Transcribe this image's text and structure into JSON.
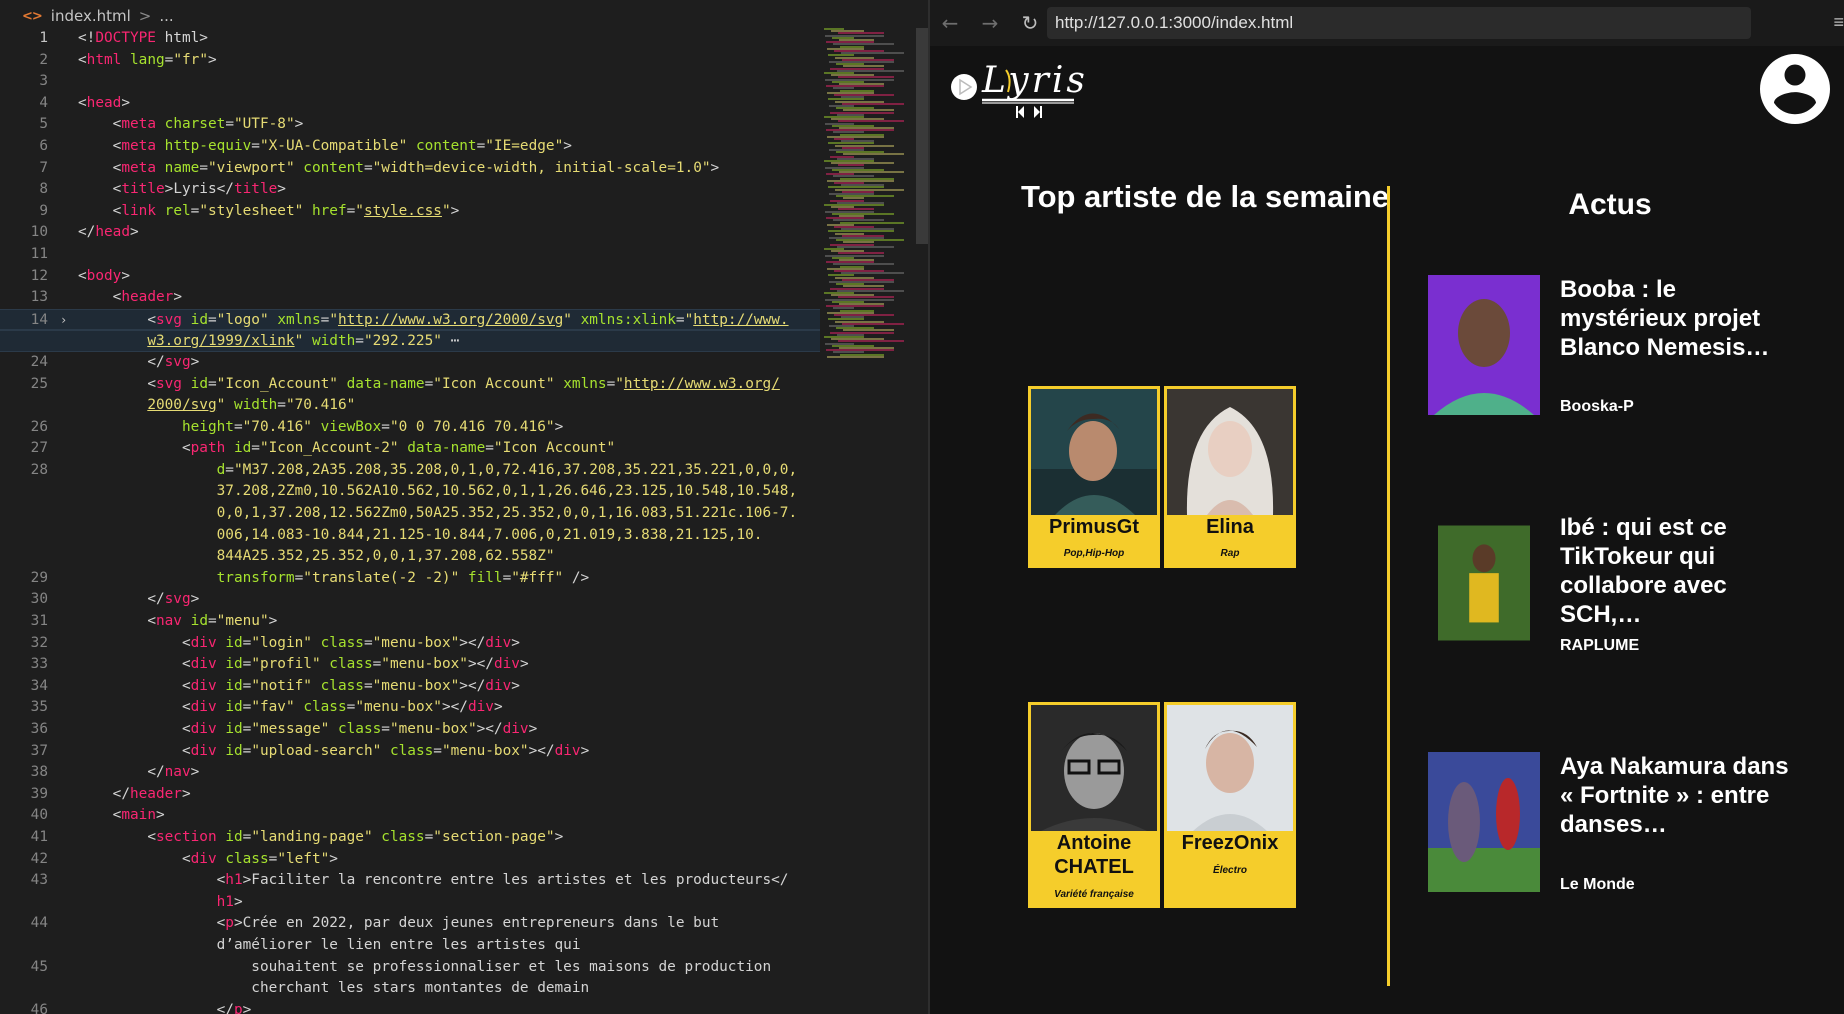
{
  "editor": {
    "breadcrumb": {
      "file": "index.html",
      "separator": ">",
      "more": "..."
    },
    "lines": [
      {
        "n": "1",
        "html": "<span class=\"txt\">&lt;!</span><span class=\"tag\">DOCTYPE</span><span class=\"txt\"> html&gt;</span>"
      },
      {
        "n": "2",
        "html": "<span class=\"txt\">&lt;</span><span class=\"tag\">html</span> <span class=\"attr\">lang</span><span class=\"txt\">=</span><span class=\"str\">\"fr\"</span><span class=\"txt\">&gt;</span>"
      },
      {
        "n": "3",
        "html": ""
      },
      {
        "n": "4",
        "html": "<span class=\"txt\">&lt;</span><span class=\"tag\">head</span><span class=\"txt\">&gt;</span>"
      },
      {
        "n": "5",
        "html": "    <span class=\"txt\">&lt;</span><span class=\"tag\">meta</span> <span class=\"attr\">charset</span><span class=\"txt\">=</span><span class=\"str\">\"UTF-8\"</span><span class=\"txt\">&gt;</span>"
      },
      {
        "n": "6",
        "html": "    <span class=\"txt\">&lt;</span><span class=\"tag\">meta</span> <span class=\"attr\">http-equiv</span><span class=\"txt\">=</span><span class=\"str\">\"X-UA-Compatible\"</span> <span class=\"attr\">content</span><span class=\"txt\">=</span><span class=\"str\">\"IE=edge\"</span><span class=\"txt\">&gt;</span>"
      },
      {
        "n": "7",
        "html": "    <span class=\"txt\">&lt;</span><span class=\"tag\">meta</span> <span class=\"attr\">name</span><span class=\"txt\">=</span><span class=\"str\">\"viewport\"</span> <span class=\"attr\">content</span><span class=\"txt\">=</span><span class=\"str\">\"width=device-width, initial-scale=1.0\"</span><span class=\"txt\">&gt;</span>"
      },
      {
        "n": "8",
        "html": "    <span class=\"txt\">&lt;</span><span class=\"tag\">title</span><span class=\"txt\">&gt;Lyris&lt;/</span><span class=\"tag\">title</span><span class=\"txt\">&gt;</span>"
      },
      {
        "n": "9",
        "html": "    <span class=\"txt\">&lt;</span><span class=\"tag\">link</span> <span class=\"attr\">rel</span><span class=\"txt\">=</span><span class=\"str\">\"stylesheet\"</span> <span class=\"attr\">href</span><span class=\"txt\">=</span><span class=\"str\">\"<span class=\"url\">style.css</span>\"</span><span class=\"txt\">&gt;</span>"
      },
      {
        "n": "10",
        "html": "<span class=\"txt\">&lt;/</span><span class=\"tag\">head</span><span class=\"txt\">&gt;</span>"
      },
      {
        "n": "11",
        "html": ""
      },
      {
        "n": "12",
        "html": "<span class=\"txt\">&lt;</span><span class=\"tag\">body</span><span class=\"txt\">&gt;</span>"
      },
      {
        "n": "13",
        "html": "    <span class=\"txt\">&lt;</span><span class=\"tag\">header</span><span class=\"txt\">&gt;</span>"
      },
      {
        "n": "14",
        "fold": true,
        "hl": true,
        "html": "        <span class=\"txt\">&lt;</span><span class=\"tag\">svg</span> <span class=\"attr\">id</span><span class=\"txt\">=</span><span class=\"str\">\"logo\"</span> <span class=\"attr\">xmlns</span><span class=\"txt\">=</span><span class=\"str\">\"<span class=\"url\">http://www.w3.org/2000/svg</span>\"</span> <span class=\"attr\">xmlns:xlink</span><span class=\"txt\">=</span><span class=\"str\">\"<span class=\"url\">http://www.</span></span>"
      },
      {
        "n": "",
        "hl": true,
        "html": "        <span class=\"str\"><span class=\"url\">w3.org/1999/xlink</span>\"</span> <span class=\"attr\">width</span><span class=\"txt\">=</span><span class=\"str\">\"292.225\"</span><span class=\"txt\"> ⋯</span>"
      },
      {
        "n": "24",
        "html": "        <span class=\"txt\">&lt;/</span><span class=\"tag\">svg</span><span class=\"txt\">&gt;</span>"
      },
      {
        "n": "25",
        "html": "        <span class=\"txt\">&lt;</span><span class=\"tag\">svg</span> <span class=\"attr\">id</span><span class=\"txt\">=</span><span class=\"str\">\"Icon_Account\"</span> <span class=\"attr\">data-name</span><span class=\"txt\">=</span><span class=\"str\">\"Icon Account\"</span> <span class=\"attr\">xmlns</span><span class=\"txt\">=</span><span class=\"str\">\"<span class=\"url\">http://www.w3.org/</span></span>"
      },
      {
        "n": "",
        "html": "        <span class=\"str\"><span class=\"url\">2000/svg</span>\"</span> <span class=\"attr\">width</span><span class=\"txt\">=</span><span class=\"str\">\"70.416\"</span>"
      },
      {
        "n": "26",
        "html": "            <span class=\"attr\">height</span><span class=\"txt\">=</span><span class=\"str\">\"70.416\"</span> <span class=\"attr\">viewBox</span><span class=\"txt\">=</span><span class=\"str\">\"0 0 70.416 70.416\"</span><span class=\"txt\">&gt;</span>"
      },
      {
        "n": "27",
        "html": "            <span class=\"txt\">&lt;</span><span class=\"tag\">path</span> <span class=\"attr\">id</span><span class=\"txt\">=</span><span class=\"str\">\"Icon_Account-2\"</span> <span class=\"attr\">data-name</span><span class=\"txt\">=</span><span class=\"str\">\"Icon Account\"</span>"
      },
      {
        "n": "28",
        "html": "                <span class=\"attr\">d</span><span class=\"txt\">=</span><span class=\"str\">\"M37.208,2A35.208,35.208,0,1,0,72.416,37.208,35.221,35.221,0,0,0,</span>"
      },
      {
        "n": "",
        "html": "                <span class=\"str\">37.208,2Zm0,10.562A10.562,10.562,0,1,1,26.646,23.125,10.548,10.548,</span>"
      },
      {
        "n": "",
        "html": "                <span class=\"str\">0,0,1,37.208,12.562Zm0,50A25.352,25.352,0,0,1,16.083,51.221c.106-7.</span>"
      },
      {
        "n": "",
        "html": "                <span class=\"str\">006,14.083-10.844,21.125-10.844,7.006,0,21.019,3.838,21.125,10.</span>"
      },
      {
        "n": "",
        "html": "                <span class=\"str\">844A25.352,25.352,0,0,1,37.208,62.558Z\"</span>"
      },
      {
        "n": "29",
        "html": "                <span class=\"attr\">transform</span><span class=\"txt\">=</span><span class=\"str\">\"translate(-2 -2)\"</span> <span class=\"attr\">fill</span><span class=\"txt\">=</span><span class=\"str\">\"#fff\"</span><span class=\"txt\"> /&gt;</span>"
      },
      {
        "n": "30",
        "html": "        <span class=\"txt\">&lt;/</span><span class=\"tag\">svg</span><span class=\"txt\">&gt;</span>"
      },
      {
        "n": "31",
        "html": "        <span class=\"txt\">&lt;</span><span class=\"tag\">nav</span> <span class=\"attr\">id</span><span class=\"txt\">=</span><span class=\"str\">\"menu\"</span><span class=\"txt\">&gt;</span>"
      },
      {
        "n": "32",
        "html": "            <span class=\"txt\">&lt;</span><span class=\"tag\">div</span> <span class=\"attr\">id</span><span class=\"txt\">=</span><span class=\"str\">\"login\"</span> <span class=\"attr\">class</span><span class=\"txt\">=</span><span class=\"str\">\"menu-box\"</span><span class=\"txt\">&gt;&lt;/</span><span class=\"tag\">div</span><span class=\"txt\">&gt;</span>"
      },
      {
        "n": "33",
        "html": "            <span class=\"txt\">&lt;</span><span class=\"tag\">div</span> <span class=\"attr\">id</span><span class=\"txt\">=</span><span class=\"str\">\"profil\"</span> <span class=\"attr\">class</span><span class=\"txt\">=</span><span class=\"str\">\"menu-box\"</span><span class=\"txt\">&gt;&lt;/</span><span class=\"tag\">div</span><span class=\"txt\">&gt;</span>"
      },
      {
        "n": "34",
        "html": "            <span class=\"txt\">&lt;</span><span class=\"tag\">div</span> <span class=\"attr\">id</span><span class=\"txt\">=</span><span class=\"str\">\"notif\"</span> <span class=\"attr\">class</span><span class=\"txt\">=</span><span class=\"str\">\"menu-box\"</span><span class=\"txt\">&gt;&lt;/</span><span class=\"tag\">div</span><span class=\"txt\">&gt;</span>"
      },
      {
        "n": "35",
        "html": "            <span class=\"txt\">&lt;</span><span class=\"tag\">div</span> <span class=\"attr\">id</span><span class=\"txt\">=</span><span class=\"str\">\"fav\"</span> <span class=\"attr\">class</span><span class=\"txt\">=</span><span class=\"str\">\"menu-box\"</span><span class=\"txt\">&gt;&lt;/</span><span class=\"tag\">div</span><span class=\"txt\">&gt;</span>"
      },
      {
        "n": "36",
        "html": "            <span class=\"txt\">&lt;</span><span class=\"tag\">div</span> <span class=\"attr\">id</span><span class=\"txt\">=</span><span class=\"str\">\"message\"</span> <span class=\"attr\">class</span><span class=\"txt\">=</span><span class=\"str\">\"menu-box\"</span><span class=\"txt\">&gt;&lt;/</span><span class=\"tag\">div</span><span class=\"txt\">&gt;</span>"
      },
      {
        "n": "37",
        "html": "            <span class=\"txt\">&lt;</span><span class=\"tag\">div</span> <span class=\"attr\">id</span><span class=\"txt\">=</span><span class=\"str\">\"upload-search\"</span> <span class=\"attr\">class</span><span class=\"txt\">=</span><span class=\"str\">\"menu-box\"</span><span class=\"txt\">&gt;&lt;/</span><span class=\"tag\">div</span><span class=\"txt\">&gt;</span>"
      },
      {
        "n": "38",
        "html": "        <span class=\"txt\">&lt;/</span><span class=\"tag\">nav</span><span class=\"txt\">&gt;</span>"
      },
      {
        "n": "39",
        "html": "    <span class=\"txt\">&lt;/</span><span class=\"tag\">header</span><span class=\"txt\">&gt;</span>"
      },
      {
        "n": "40",
        "html": "    <span class=\"txt\">&lt;</span><span class=\"tag\">main</span><span class=\"txt\">&gt;</span>"
      },
      {
        "n": "41",
        "html": "        <span class=\"txt\">&lt;</span><span class=\"tag\">section</span> <span class=\"attr\">id</span><span class=\"txt\">=</span><span class=\"str\">\"landing-page\"</span> <span class=\"attr\">class</span><span class=\"txt\">=</span><span class=\"str\">\"section-page\"</span><span class=\"txt\">&gt;</span>"
      },
      {
        "n": "42",
        "html": "            <span class=\"txt\">&lt;</span><span class=\"tag\">div</span> <span class=\"attr\">class</span><span class=\"txt\">=</span><span class=\"str\">\"left\"</span><span class=\"txt\">&gt;</span>"
      },
      {
        "n": "43",
        "html": "                <span class=\"txt\">&lt;</span><span class=\"tag\">h1</span><span class=\"txt\">&gt;Faciliter la rencontre entre les artistes et les producteurs&lt;/</span>"
      },
      {
        "n": "",
        "html": "                <span class=\"tag\">h1</span><span class=\"txt\">&gt;</span>"
      },
      {
        "n": "44",
        "html": "                <span class=\"txt\">&lt;</span><span class=\"tag\">p</span><span class=\"txt\">&gt;Crée en 2022, par deux jeunes entrepreneurs dans le but</span>"
      },
      {
        "n": "",
        "html": "                <span class=\"txt\">d’améliorer le lien entre les artistes qui</span>"
      },
      {
        "n": "45",
        "html": "                    <span class=\"txt\">souhaitent se professionnaliser et les maisons de production</span>"
      },
      {
        "n": "",
        "html": "                    <span class=\"txt\">cherchant les stars montantes de demain</span>"
      },
      {
        "n": "46",
        "html": "                <span class=\"txt\">&lt;/</span><span class=\"tag\">p</span><span class=\"txt\">&gt;</span>"
      }
    ]
  },
  "browser": {
    "url": "http://127.0.0.1:3000/index.html",
    "icons": {
      "back": "arrow-left-icon",
      "forward": "arrow-right-icon",
      "reload": "reload-icon",
      "menu": "more-icon"
    },
    "page": {
      "logo_text": "Lyris",
      "top_title": "Top artiste de la semaine",
      "actus_title": "Actus",
      "accent_color": "#f5cd2b",
      "artists": [
        {
          "name": "PrimusGt",
          "genre": "Pop,Hip-Hop"
        },
        {
          "name": "Elina",
          "genre": "Rap"
        },
        {
          "name": "Antoine CHATEL",
          "genre": "Variété française"
        },
        {
          "name": "FreezOnix",
          "genre": "Électro"
        }
      ],
      "news": [
        {
          "headline": "Booba : le mystérieux projet Blanco Nemesis…",
          "source": "Booska-P"
        },
        {
          "headline": "Ibé : qui est ce TikTokeur qui collabore avec SCH,…",
          "source": "RAPLUME"
        },
        {
          "headline": "Aya Nakamura dans « Fortnite » : entre danses…",
          "source": "Le Monde"
        }
      ]
    }
  }
}
